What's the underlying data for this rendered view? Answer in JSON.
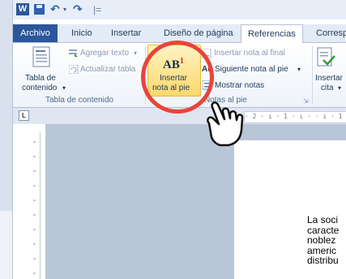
{
  "quick_access": {
    "app_letter": "W",
    "save_icon": "save-icon",
    "undo_icon": "undo-icon",
    "redo_icon": "redo-icon",
    "customize": "|="
  },
  "tabs": [
    "Archivo",
    "Inicio",
    "Insertar",
    "Diseño de página",
    "Referencias",
    "Corresp"
  ],
  "active_tab": "Referencias",
  "ribbon": {
    "toc": {
      "label_line1": "Tabla de",
      "label_line2": "contenido",
      "agregar_texto": "Agregar texto",
      "actualizar_tabla": "Actualizar tabla",
      "group_label": "Tabla de contenido"
    },
    "notes": {
      "insert_footnote_line1": "Insertar",
      "insert_footnote_line2": "nota al pie",
      "icon_text": "AB",
      "icon_sup": "1",
      "insert_endnote": "Insertar nota al final",
      "next_footnote": "Siguiente nota al pie",
      "show_notes": "Mostrar notas",
      "group_label": "Notas al pie"
    },
    "citations": {
      "label_line1": "Insertar",
      "label_line2": "cita"
    }
  },
  "ruler": {
    "tab_symbol": "L",
    "scale": "· 2 · ı · 1 · ı ·  · ı · 1 ·"
  },
  "document": {
    "lines": [
      "La soci",
      "caracte",
      "noblez",
      "americ",
      "distribu"
    ]
  },
  "colors": {
    "file_tab": "#2b579a",
    "highlight": "#fbd86a",
    "annotation_circle": "#e9443a"
  }
}
